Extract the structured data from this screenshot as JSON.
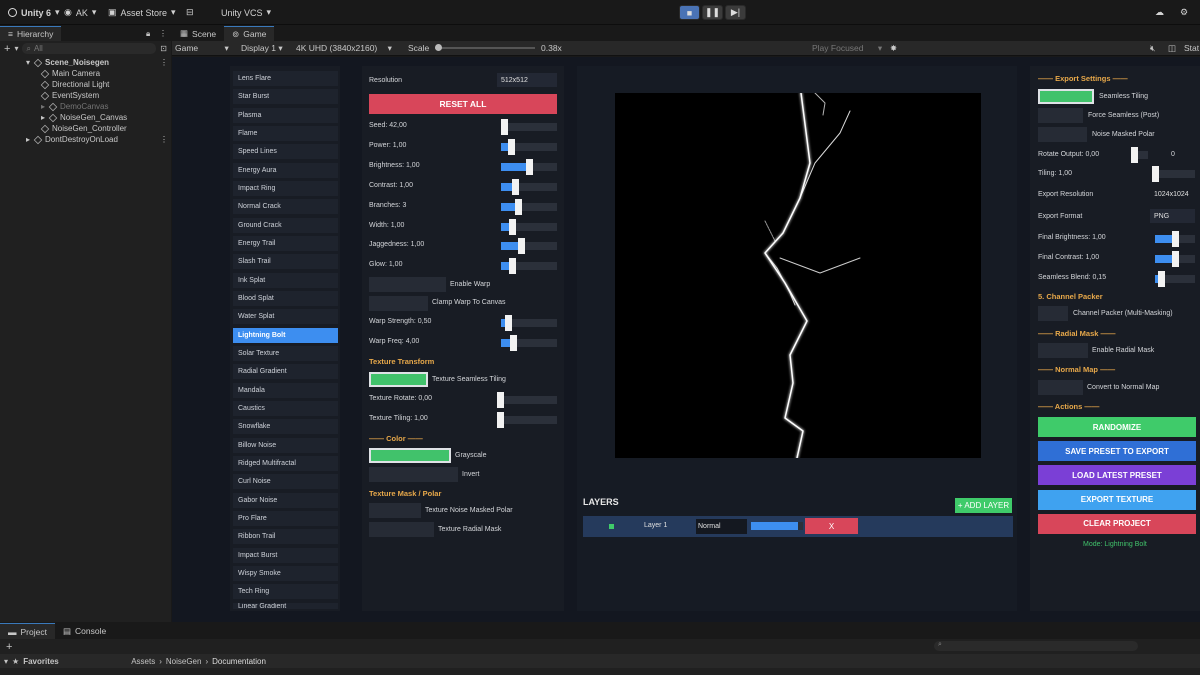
{
  "topbar": {
    "unity": "Unity 6",
    "account": "AK",
    "asset_store": "Asset Store",
    "vcs": "Unity VCS"
  },
  "hierarchy": {
    "tab": "Hierarchy",
    "search_placeholder": "All",
    "items": [
      {
        "label": "Scene_Noisegen",
        "level": 0,
        "bold": true,
        "dim": false
      },
      {
        "label": "Main Camera",
        "level": 1,
        "dim": false
      },
      {
        "label": "Directional Light",
        "level": 1,
        "dim": false
      },
      {
        "label": "EventSystem",
        "level": 1,
        "dim": false
      },
      {
        "label": "DemoCanvas",
        "level": 1,
        "dim": true
      },
      {
        "label": "NoiseGen_Canvas",
        "level": 1,
        "dim": false
      },
      {
        "label": "NoiseGen_Controller",
        "level": 1,
        "dim": false
      },
      {
        "label": "DontDestroyOnLoad",
        "level": 0,
        "dim": false
      }
    ]
  },
  "tabs": {
    "scene": "Scene",
    "game": "Game"
  },
  "gametoolbar": {
    "mode": "Game",
    "display": "Display 1",
    "resolution": "4K UHD (3840x2160)",
    "scale_label": "Scale",
    "scale_value": "0.38x",
    "play_focused": "Play Focused",
    "stats": "Stat"
  },
  "modes": [
    "Lens Flare",
    "Star Burst",
    "Plasma",
    "Flame",
    "Speed Lines",
    "Energy Aura",
    "Impact Ring",
    "Normal Crack",
    "Ground Crack",
    "Energy Trail",
    "Slash Trail",
    "Ink Splat",
    "Blood Splat",
    "Water Splat",
    "Lightning Bolt",
    "Solar Texture",
    "Radial Gradient",
    "Mandala",
    "Caustics",
    "Snowflake",
    "Billow Noise",
    "Ridged Multifractal",
    "Curl Noise",
    "Gabor Noise",
    "Pro Flare",
    "Ribbon Trail",
    "Impact Burst",
    "Wispy Smoke",
    "Tech Ring",
    "Linear Gradient"
  ],
  "selected_mode": "Lightning Bolt",
  "params": {
    "resolution_label": "Resolution",
    "resolution_value": "512x512",
    "reset": "RESET ALL",
    "sliders": [
      {
        "label": "Seed: 42,00",
        "value": 0.05
      },
      {
        "label": "Power: 1,00",
        "value": 0.17
      },
      {
        "label": "Brightness: 1,00",
        "value": 0.5
      },
      {
        "label": "Contrast: 1,00",
        "value": 0.25
      },
      {
        "label": "Branches: 3",
        "value": 0.3
      },
      {
        "label": "Width: 1,00",
        "value": 0.2
      },
      {
        "label": "Jaggedness: 1,00",
        "value": 0.35
      },
      {
        "label": "Glow: 1,00",
        "value": 0.2
      }
    ],
    "enable_warp": "Enable Warp",
    "clamp_warp": "Clamp Warp To Canvas",
    "warp_sliders": [
      {
        "label": "Warp Strength: 0,50",
        "value": 0.12
      },
      {
        "label": "Warp Freq: 4,00",
        "value": 0.22
      }
    ],
    "texture_transform": "Texture Transform",
    "texture_seamless": "Texture Seamless Tiling",
    "tex_sliders": [
      {
        "label": "Texture Rotate: 0,00",
        "value": 0.0
      },
      {
        "label": "Texture Tiling: 1,00",
        "value": 0.0
      }
    ],
    "color_title": "—— Color ——",
    "grayscale": "Grayscale",
    "invert": "Invert",
    "mask_title": "Texture Mask / Polar",
    "tex_noise_masked": "Texture Noise Masked Polar",
    "tex_radial_mask": "Texture Radial Mask"
  },
  "layers": {
    "title": "LAYERS",
    "add": "+ ADD LAYER",
    "layer_name": "Layer 1",
    "blend": "Normal",
    "remove": "X",
    "opacity": 0.9
  },
  "export": {
    "title": "—— Export Settings ——",
    "seamless": "Seamless Tiling",
    "force_seamless": "Force Seamless (Post)",
    "noise_masked": "Noise Masked Polar",
    "rotate_label": "Rotate Output: 0,00",
    "rotate_value": "0",
    "rotate_pos": 0.0,
    "tiling_label": "Tiling: 1,00",
    "tiling_pos": 0.0,
    "res_label": "Export Resolution",
    "res_value": "1024x1024",
    "fmt_label": "Export Format",
    "fmt_value": "PNG",
    "final_sliders": [
      {
        "label": "Final Brightness: 1,00",
        "value": 0.5
      },
      {
        "label": "Final Contrast: 1,00",
        "value": 0.5
      },
      {
        "label": "Seamless Blend: 0,15",
        "value": 0.15
      }
    ],
    "channel_title": "5. Channel Packer",
    "channel_label": "Channel Packer (Multi-Masking)",
    "radial_title": "—— Radial Mask ——",
    "radial_label": "Enable Radial Mask",
    "normal_title": "—— Normal Map ——",
    "normal_label": "Convert to Normal Map",
    "actions_title": "—— Actions ——",
    "buttons": [
      {
        "label": "RANDOMIZE",
        "color": "#3fcb6a"
      },
      {
        "label": "SAVE PRESET TO EXPORT",
        "color": "#2f6fd6"
      },
      {
        "label": "LOAD LATEST PRESET",
        "color": "#7b3fd6"
      },
      {
        "label": "EXPORT TEXTURE",
        "color": "#3fa2f0"
      },
      {
        "label": "CLEAR PROJECT",
        "color": "#d8465a"
      }
    ],
    "mode_status": "Mode: Lightning Bolt"
  },
  "bottom": {
    "project_tab": "Project",
    "console_tab": "Console",
    "favorites": "Favorites",
    "path": [
      "Assets",
      "NoiseGen",
      "Documentation"
    ]
  },
  "colors": {
    "accent": "#3d8ef0",
    "toggle_on": "#41c26b",
    "reset": "#d8465a",
    "section": "#e7a84a",
    "status": "#41c26b"
  }
}
